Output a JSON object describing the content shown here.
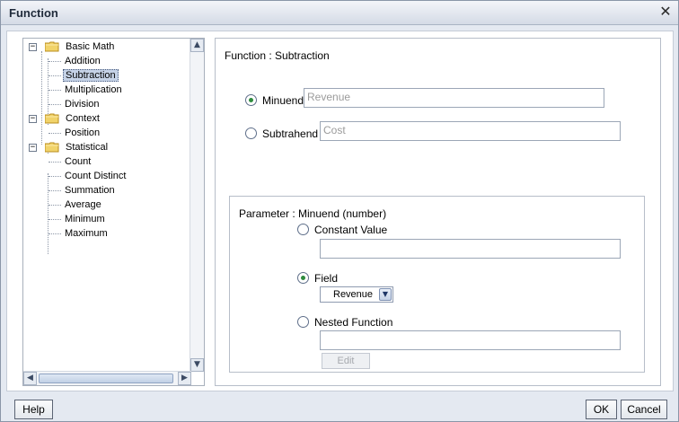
{
  "window": {
    "title": "Function"
  },
  "tree": {
    "groups": [
      {
        "label": "Basic Math",
        "items": [
          "Addition",
          "Subtraction",
          "Multiplication",
          "Division"
        ]
      },
      {
        "label": "Context",
        "items": [
          "Position"
        ]
      },
      {
        "label": "Statistical",
        "items": [
          "Count",
          "Count Distinct",
          "Summation",
          "Average",
          "Minimum",
          "Maximum"
        ]
      }
    ],
    "selected": "Subtraction"
  },
  "function": {
    "heading": "Function : Subtraction",
    "minuend": {
      "label": "Minuend",
      "value": "Revenue",
      "checked": true
    },
    "subtrahend": {
      "label": "Subtrahend",
      "value": "Cost",
      "checked": false
    }
  },
  "parameter": {
    "heading": "Parameter : Minuend (number)",
    "constant_label": "Constant Value",
    "constant_value": "",
    "field_label": "Field",
    "field_value": "Revenue",
    "nested_label": "Nested Function",
    "nested_value": "",
    "edit_label": "Edit"
  },
  "footer": {
    "help": "Help",
    "ok": "OK",
    "cancel": "Cancel"
  },
  "colors": {
    "accent_radio": "#2e8b3e",
    "selection": "#c5d2e6",
    "frame": "#e4e9f1"
  }
}
